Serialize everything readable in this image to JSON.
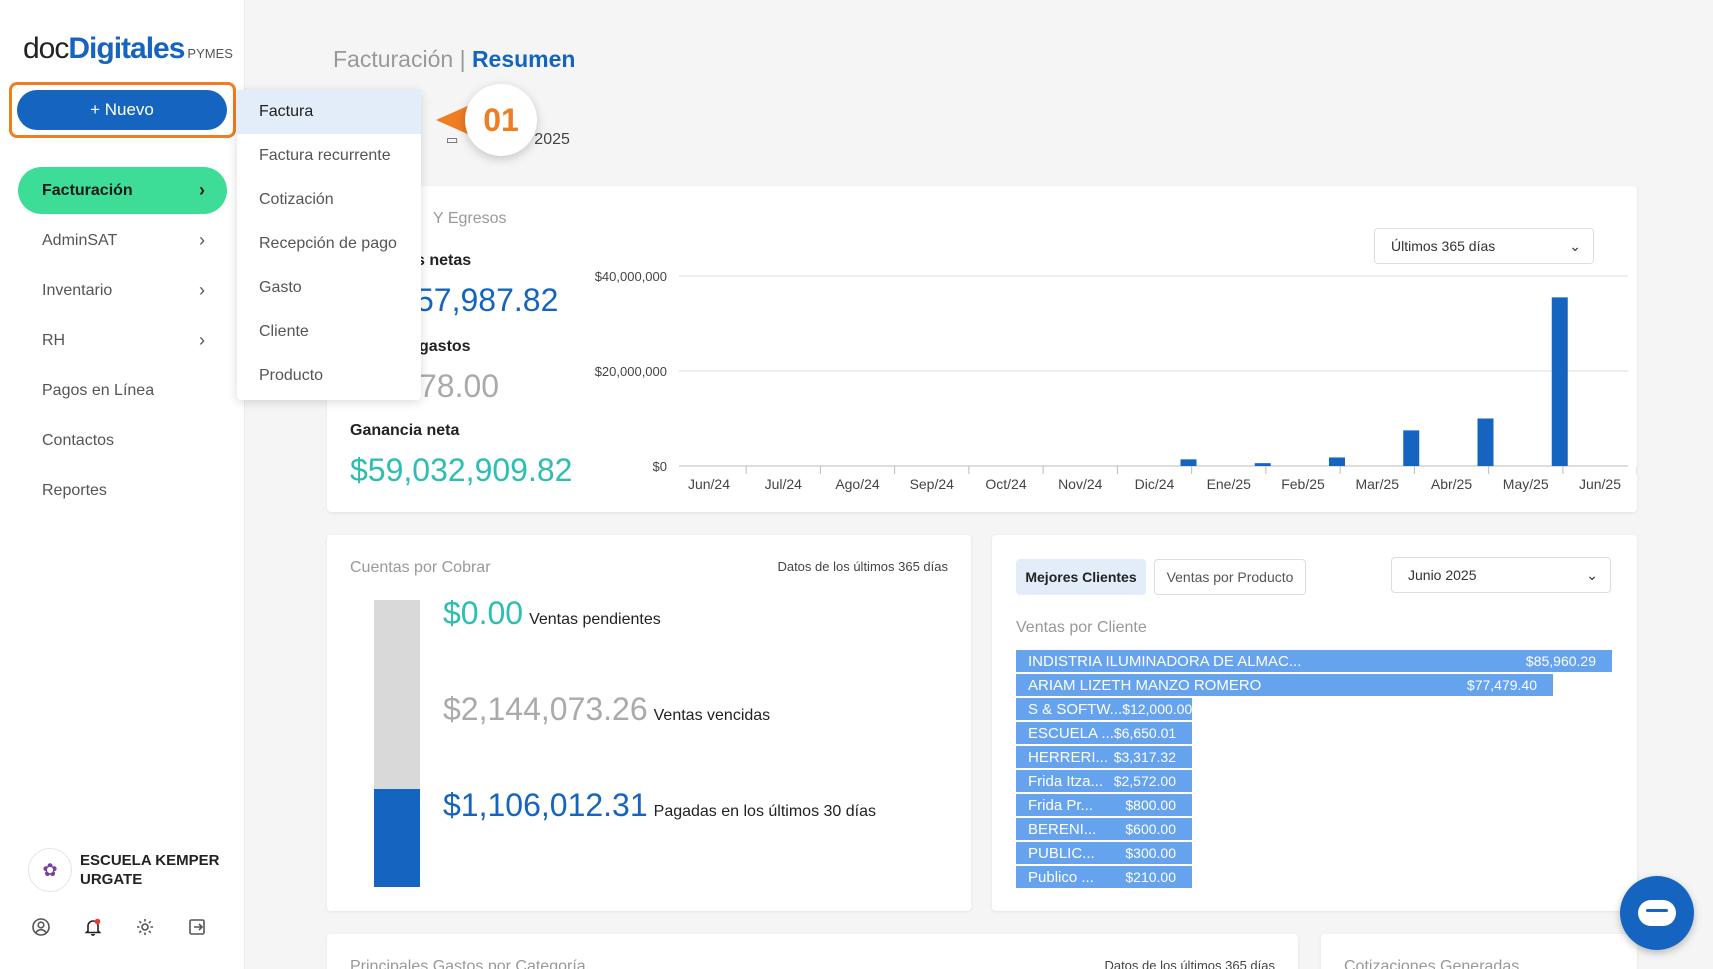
{
  "sidebar": {
    "logo": {
      "doc": "doc",
      "digitales": "Digitales",
      "pymes": "PYMES"
    },
    "nuevo_label": "+ Nuevo",
    "items": [
      {
        "label": "Facturación",
        "chevron": true,
        "active": true
      },
      {
        "label": "AdminSAT",
        "chevron": true
      },
      {
        "label": "Inventario",
        "chevron": true
      },
      {
        "label": "RH",
        "chevron": true
      },
      {
        "label": "Pagos en Línea",
        "chevron": false
      },
      {
        "label": "Contactos",
        "chevron": false
      },
      {
        "label": "Reportes",
        "chevron": false
      }
    ],
    "user": {
      "name": "ESCUELA KEMPER URGATE"
    },
    "footer_icons": [
      "user-circle-icon",
      "bell-icon",
      "gear-icon",
      "logout-icon"
    ]
  },
  "dropdown": {
    "items": [
      "Factura",
      "Factura recurrente",
      "Cotización",
      "Recepción de pago",
      "Gasto",
      "Cliente",
      "Producto"
    ]
  },
  "callout": {
    "label": "01"
  },
  "header": {
    "section": "Facturación",
    "separator": "|",
    "page": "Resumen",
    "date_partial": "2025"
  },
  "summary": {
    "title_partial": "Y Egresos",
    "sales_label_partial": "s netas",
    "sales_value_partial": "57,987.82",
    "expenses_label_partial": "gastos",
    "expenses_value_partial": "78.00",
    "profit_label": "Ganancia neta",
    "profit_value": "$59,032,909.82",
    "range_select": "Últimos 365 días"
  },
  "chart_data": {
    "type": "bar",
    "categories": [
      "Jun/24",
      "Jul/24",
      "Ago/24",
      "Sep/24",
      "Oct/24",
      "Nov/24",
      "Dic/24",
      "Ene/25",
      "Feb/25",
      "Mar/25",
      "Abr/25",
      "May/25",
      "Jun/25"
    ],
    "values": [
      0,
      0,
      0,
      0,
      0,
      0,
      1400000,
      600000,
      1800000,
      7500000,
      10000000,
      35500000,
      0
    ],
    "y_ticks": [
      "$0",
      "$20,000,000",
      "$40,000,000"
    ],
    "ylim": [
      0,
      40000000
    ],
    "grid": true,
    "color": "#1565c0"
  },
  "cxc": {
    "title": "Cuentas por Cobrar",
    "note": "Datos de los últimos 365 días",
    "rows": [
      {
        "amount": "$0.00",
        "label": "Ventas pendientes",
        "color": "#2bbfb3"
      },
      {
        "amount": "$2,144,073.26",
        "label": "Ventas vencidas",
        "color": "#aaaaaa"
      },
      {
        "amount": "$1,106,012.31",
        "label": "Pagadas en los últimos 30 días",
        "color": "#1565c0"
      }
    ],
    "bar": {
      "gray_fraction": 0.66,
      "blue_fraction": 0.34
    }
  },
  "clients": {
    "tab_active": "Mejores Clientes",
    "tab_other": "Ventas por Producto",
    "month_select": "Junio 2025",
    "subtitle": "Ventas por Cliente",
    "rows": [
      {
        "name": "INDISTRIA ILUMINADORA DE ALMAC...",
        "amount": "$85,960.29",
        "value": 85960.29
      },
      {
        "name": "ARIAM LIZETH MANZO ROMERO",
        "amount": "$77,479.40",
        "value": 77479.4
      },
      {
        "name": "S & SOFTW...",
        "amount": "$12,000.00",
        "value": 12000
      },
      {
        "name": "ESCUELA ...",
        "amount": "$6,650.01",
        "value": 6650.01
      },
      {
        "name": "HERRERI...",
        "amount": "$3,317.32",
        "value": 3317.32
      },
      {
        "name": "Frida Itza...",
        "amount": "$2,572.00",
        "value": 2572
      },
      {
        "name": "Frida Pr...",
        "amount": "$800.00",
        "value": 800
      },
      {
        "name": "BERENI...",
        "amount": "$600.00",
        "value": 600
      },
      {
        "name": "PUBLIC...",
        "amount": "$300.00",
        "value": 300
      },
      {
        "name": "Publico ...",
        "amount": "$210.00",
        "value": 210
      }
    ]
  },
  "bottom": {
    "gastos_title": "Principales Gastos por Categoría",
    "gastos_note": "Datos de los últimos 365 días",
    "cot_title": "Cotizaciones Generadas"
  }
}
